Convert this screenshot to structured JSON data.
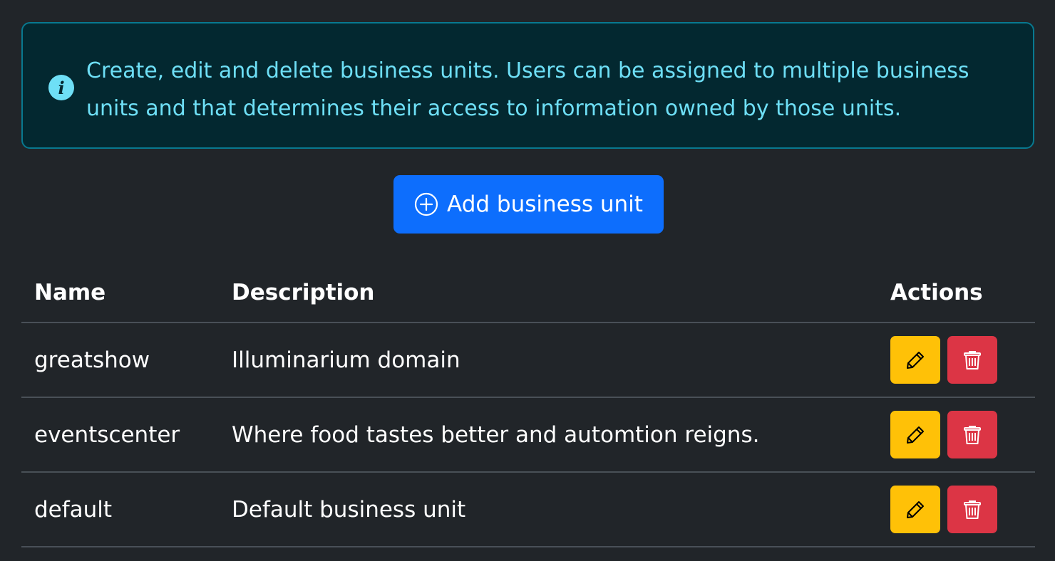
{
  "alert": {
    "icon": "info-icon",
    "text": "Create, edit and delete business units. Users can be assigned to multiple business units and that determines their access to information owned by those units."
  },
  "add_button": {
    "icon": "plus-circle-icon",
    "label": "Add business unit"
  },
  "table": {
    "headers": {
      "name": "Name",
      "description": "Description",
      "actions": "Actions"
    },
    "rows": [
      {
        "name": "greatshow",
        "description": "Illuminarium domain"
      },
      {
        "name": "eventscenter",
        "description": "Where food tastes better and automtion reigns."
      },
      {
        "name": "default",
        "description": "Default business unit"
      }
    ]
  },
  "colors": {
    "background": "#212529",
    "alert_bg": "#032830",
    "alert_border": "#087990",
    "alert_text": "#6edff6",
    "primary": "#0d6efd",
    "warning": "#ffc107",
    "danger": "#dc3545"
  }
}
